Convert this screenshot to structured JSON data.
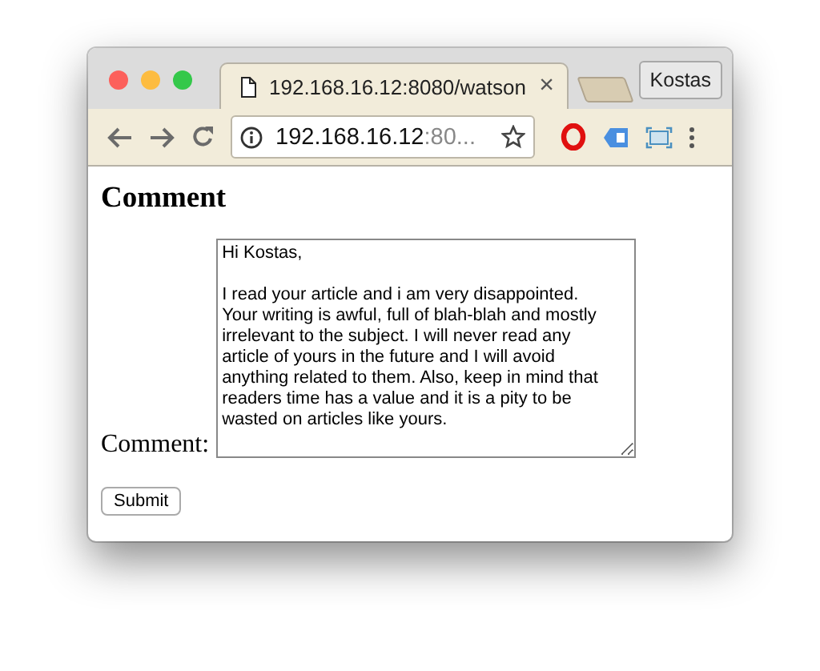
{
  "tab": {
    "title": "192.168.16.12:8080/watson",
    "close": "×"
  },
  "profile_button": "Kostas",
  "address_bar": {
    "host": "192.168.16.12",
    "rest": ":80..."
  },
  "page": {
    "heading": "Comment",
    "label": "Comment:",
    "comment": "Hi Kostas,\n\nI read your article and i am very disappointed. Your writing is awful, full of blah-blah and mostly irrelevant to the subject. I will never read any article of yours in the future and I will avoid anything related to them. Also, keep in mind that readers time has a value and it is a pity to be wasted on articles like yours.",
    "submit": "Submit"
  }
}
